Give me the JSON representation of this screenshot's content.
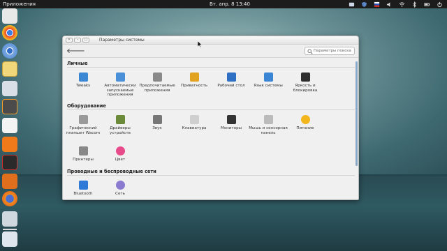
{
  "top_panel": {
    "apps_label": "Приложения",
    "clock": "Вт. апр.  8 13:40"
  },
  "tray_icons": [
    "network-icon",
    "shield-icon",
    "flag-icon",
    "volume-icon",
    "wifi-icon",
    "bluetooth-icon",
    "battery-icon",
    "power-icon"
  ],
  "dock_icons": [
    "home-folder-icon",
    "chrome-icon",
    "chromium-icon",
    "mail-icon",
    "disks-icon",
    "sublime-icon",
    "text-editor-icon",
    "music-icon",
    "video-icon",
    "photos-icon",
    "firefox-icon",
    "drive-icon",
    "workspace-switcher-icon"
  ],
  "window": {
    "title": "Параметры системы",
    "search_placeholder": "Параметры поиска",
    "sections": [
      {
        "title": "Личные",
        "items": [
          {
            "label": "Tweaks",
            "icon": "tweaks-icon"
          },
          {
            "label": "Автоматически запускаемые приложения",
            "icon": "startup-apps-icon"
          },
          {
            "label": "Предпочитаемые приложения",
            "icon": "preferred-apps-icon"
          },
          {
            "label": "Приватность",
            "icon": "privacy-icon"
          },
          {
            "label": "Рабочий стол",
            "icon": "desktop-icon"
          },
          {
            "label": "Язык системы",
            "icon": "language-icon"
          },
          {
            "label": "Яркость и блокировка",
            "icon": "brightness-icon"
          }
        ]
      },
      {
        "title": "Оборудование",
        "items": [
          {
            "label": "Графический планшет Wacom",
            "icon": "wacom-icon"
          },
          {
            "label": "Драйверы устройств",
            "icon": "drivers-icon"
          },
          {
            "label": "Звук",
            "icon": "sound-icon"
          },
          {
            "label": "Клавиатура",
            "icon": "keyboard-icon"
          },
          {
            "label": "Мониторы",
            "icon": "displays-icon"
          },
          {
            "label": "Мышь и сенсорная панель",
            "icon": "mouse-icon"
          },
          {
            "label": "Питание",
            "icon": "power-settings-icon"
          },
          {
            "label": "Принтеры",
            "icon": "printers-icon"
          },
          {
            "label": "Цвет",
            "icon": "color-icon"
          }
        ]
      },
      {
        "title": "Проводные и беспроводные сети",
        "items": [
          {
            "label": "Bluetooth",
            "icon": "bluetooth-settings-icon"
          },
          {
            "label": "Сеть",
            "icon": "network-settings-icon"
          }
        ]
      }
    ]
  },
  "colors": {
    "panel_bg": "#1c1c1c",
    "window_bg": "#f0f0f0",
    "accent": "#3b87d4"
  }
}
